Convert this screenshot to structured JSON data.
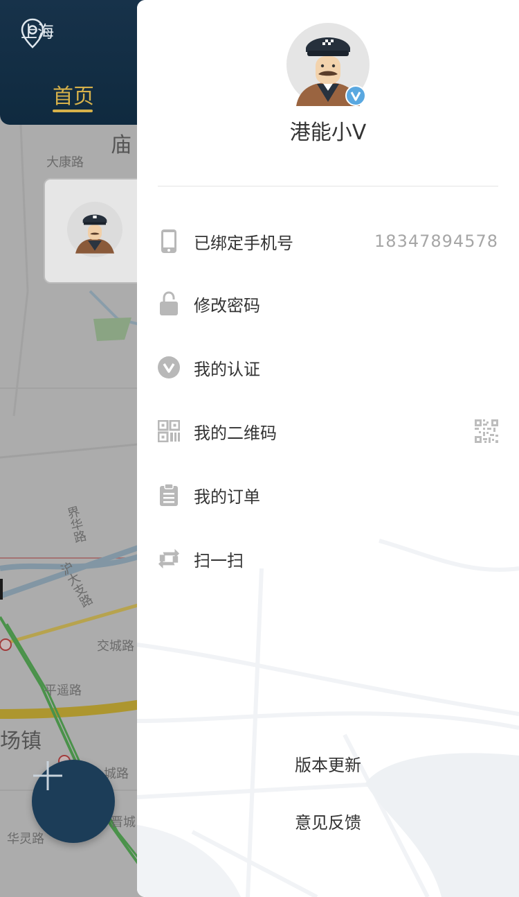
{
  "header": {
    "city": "上海",
    "home_tab": "首页"
  },
  "map_labels": {
    "temple": "庙",
    "road_dakang": "大康路",
    "road_jiehua": "界华路",
    "road_hudazhi": "沪大支路",
    "road_jiaocheng": "交城路",
    "road_pingyao": "平遥路",
    "town": "场镇",
    "road_cheng": "城路",
    "road_jincheng": "晋城",
    "road_hualing": "华灵路"
  },
  "drawer": {
    "username": "港能小V",
    "menu": [
      {
        "label": "已绑定手机号",
        "value": "18347894578",
        "icon": "phone-icon"
      },
      {
        "label": "修改密码",
        "icon": "lock-icon"
      },
      {
        "label": "我的认证",
        "icon": "verify-icon"
      },
      {
        "label": "我的二维码",
        "icon": "qrcode-icon"
      },
      {
        "label": "我的订单",
        "icon": "clipboard-icon"
      },
      {
        "label": "扫一扫",
        "icon": "scan-icon"
      }
    ],
    "footer": {
      "version_update": "版本更新",
      "feedback": "意见反馈"
    }
  },
  "colors": {
    "header_bg": "#17324a",
    "accent_gold": "#d6b14a",
    "fab_bg": "#1c3d58",
    "icon_gray": "#b8b8b8",
    "verified_blue": "#5aa8e0"
  }
}
